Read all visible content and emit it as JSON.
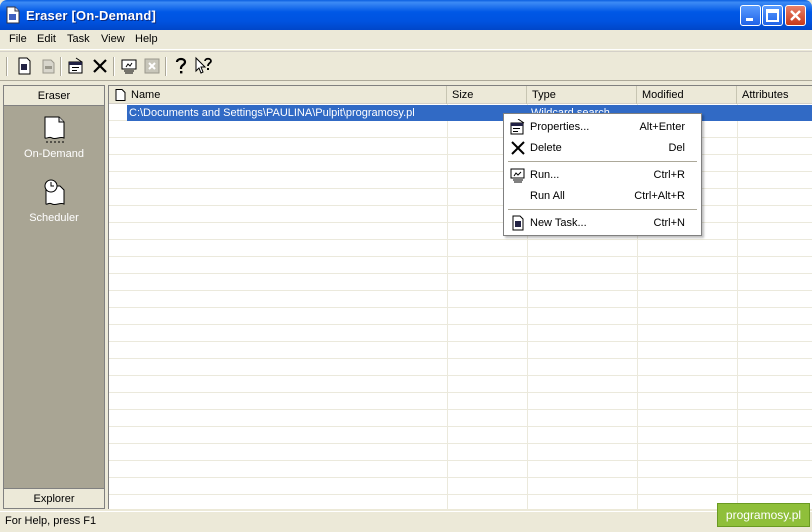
{
  "window": {
    "title": "Eraser  [On-Demand]"
  },
  "menu": {
    "items": [
      "File",
      "Edit",
      "Task",
      "View",
      "Help"
    ]
  },
  "sidebar": {
    "header": "Eraser",
    "footer": "Explorer",
    "items": [
      {
        "label": "On-Demand"
      },
      {
        "label": "Scheduler"
      }
    ]
  },
  "list": {
    "columns": [
      "Name",
      "Size",
      "Type",
      "Modified",
      "Attributes"
    ],
    "rows": [
      {
        "name": "C:\\Documents and Settings\\PAULINA\\Pulpit\\programosy.pl",
        "size": "",
        "type": "Wildcard search",
        "modified": "",
        "attributes": ""
      }
    ]
  },
  "context_menu": {
    "items": [
      {
        "label": "Properties...",
        "shortcut": "Alt+Enter"
      },
      {
        "label": "Delete",
        "shortcut": "Del"
      },
      {
        "label": "Run...",
        "shortcut": "Ctrl+R"
      },
      {
        "label": "Run All",
        "shortcut": "Ctrl+Alt+R"
      },
      {
        "label": "New Task...",
        "shortcut": "Ctrl+N"
      }
    ]
  },
  "status": {
    "text": "For Help, press F1"
  },
  "watermark": {
    "text": "programosy.pl"
  },
  "colors": {
    "titlebar": "#0058e6",
    "selection": "#316ac5",
    "sidebar": "#a9a594",
    "watermark": "#8fbf3a"
  }
}
